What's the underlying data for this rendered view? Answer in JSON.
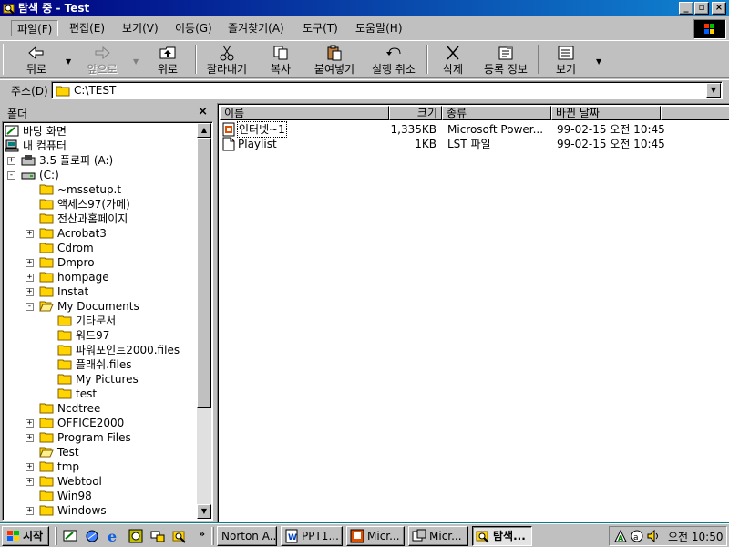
{
  "window": {
    "title": "탐색 중 - Test"
  },
  "menu": [
    "파일(F)",
    "편집(E)",
    "보기(V)",
    "이동(G)",
    "즐겨찾기(A)",
    "도구(T)",
    "도움말(H)"
  ],
  "toolbar": {
    "back": "뒤로",
    "forward": "앞으로",
    "up": "위로",
    "cut": "잘라내기",
    "copy": "복사",
    "paste": "붙여넣기",
    "undo": "실행 취소",
    "delete": "삭제",
    "properties": "등록 정보",
    "views": "보기"
  },
  "address": {
    "label": "주소(D)",
    "value": "C:\\TEST"
  },
  "folders": {
    "title": "폴더",
    "close": "×",
    "items": [
      {
        "label": "바탕 화면",
        "icon": "desktop"
      },
      {
        "label": "내 컴퓨터",
        "icon": "computer"
      },
      {
        "label": "3.5 플로피 (A:)",
        "icon": "floppy"
      },
      {
        "label": "(C:)",
        "icon": "drive"
      },
      {
        "label": "~mssetup.t",
        "icon": "folder"
      },
      {
        "label": "액세스97(가메)",
        "icon": "folder"
      },
      {
        "label": "전산과홈페이지",
        "icon": "folder"
      },
      {
        "label": "Acrobat3",
        "icon": "folder"
      },
      {
        "label": "Cdrom",
        "icon": "folder"
      },
      {
        "label": "Dmpro",
        "icon": "folder"
      },
      {
        "label": "hompage",
        "icon": "folder"
      },
      {
        "label": "Instat",
        "icon": "folder"
      },
      {
        "label": "My Documents",
        "icon": "folder-open"
      },
      {
        "label": "기타문서",
        "icon": "folder"
      },
      {
        "label": "워드97",
        "icon": "folder"
      },
      {
        "label": "파워포인트2000.files",
        "icon": "folder"
      },
      {
        "label": "플래쉬.files",
        "icon": "folder"
      },
      {
        "label": "My Pictures",
        "icon": "folder"
      },
      {
        "label": "test",
        "icon": "folder"
      },
      {
        "label": "Ncdtree",
        "icon": "folder"
      },
      {
        "label": "OFFICE2000",
        "icon": "folder"
      },
      {
        "label": "Program Files",
        "icon": "folder"
      },
      {
        "label": "Test",
        "icon": "folder-open"
      },
      {
        "label": "tmp",
        "icon": "folder"
      },
      {
        "label": "Webtool",
        "icon": "folder"
      },
      {
        "label": "Win98",
        "icon": "folder"
      },
      {
        "label": "Windows",
        "icon": "folder"
      }
    ]
  },
  "files": {
    "columns": [
      "이름",
      "크기",
      "종류",
      "바뀐 날짜"
    ],
    "rows": [
      {
        "name": "인터넷~1",
        "size": "1,335KB",
        "type": "Microsoft Power...",
        "date": "99-02-15 오전 10:45",
        "icon": "powerpoint-file"
      },
      {
        "name": "Playlist",
        "size": "1KB",
        "type": "LST 파일",
        "date": "99-02-15 오전 10:45",
        "icon": "text-file"
      }
    ]
  },
  "taskbar": {
    "start": "시작",
    "more": "»",
    "buttons": [
      {
        "label": "Norton A...",
        "icon": "none"
      },
      {
        "label": "PPT1...",
        "icon": "word-file"
      },
      {
        "label": "Micr...",
        "icon": "powerpoint-file"
      },
      {
        "label": "Micr...",
        "icon": "app"
      },
      {
        "label": "탐색...",
        "icon": "explorer"
      }
    ],
    "clock": "오전 10:50"
  },
  "colors": {
    "title_start": "#000080",
    "title_end": "#1084d0",
    "face": "#c0c0c0",
    "desktop": "#008080"
  }
}
